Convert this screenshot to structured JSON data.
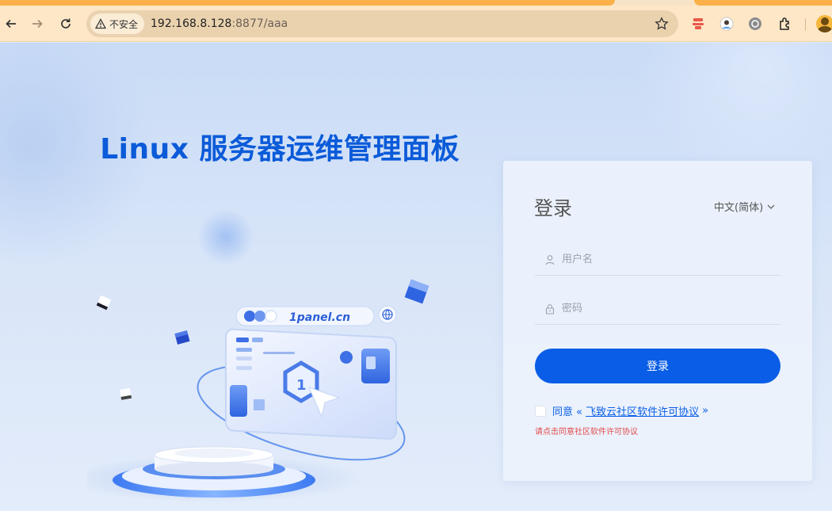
{
  "browser": {
    "security_label": "不安全",
    "url_host": "192.168.8.128",
    "url_path": ":8877/aaa",
    "icons": [
      "back-arrow-icon",
      "forward-arrow-icon",
      "reload-icon",
      "warning-icon",
      "star-icon",
      "extension-icon",
      "profile-avatar-icon"
    ]
  },
  "hero": {
    "headline": "Linux 服务器运维管理面板",
    "illustration_label": "1panel.cn"
  },
  "login": {
    "title": "登录",
    "language": "中文(简体)",
    "username_placeholder": "用户名",
    "password_placeholder": "密码",
    "submit_label": "登录",
    "agree_prefix": "同意 «",
    "agreement_link": "飞致云社区软件许可协议",
    "agree_suffix": "»",
    "agreement_hint": "请点击同意社区软件许可协议"
  },
  "colors": {
    "brand_blue": "#0a5de6",
    "headline_blue": "#0b5bd9",
    "error_red": "#e24a4a",
    "toolbar_bg": "#fde7c6"
  }
}
